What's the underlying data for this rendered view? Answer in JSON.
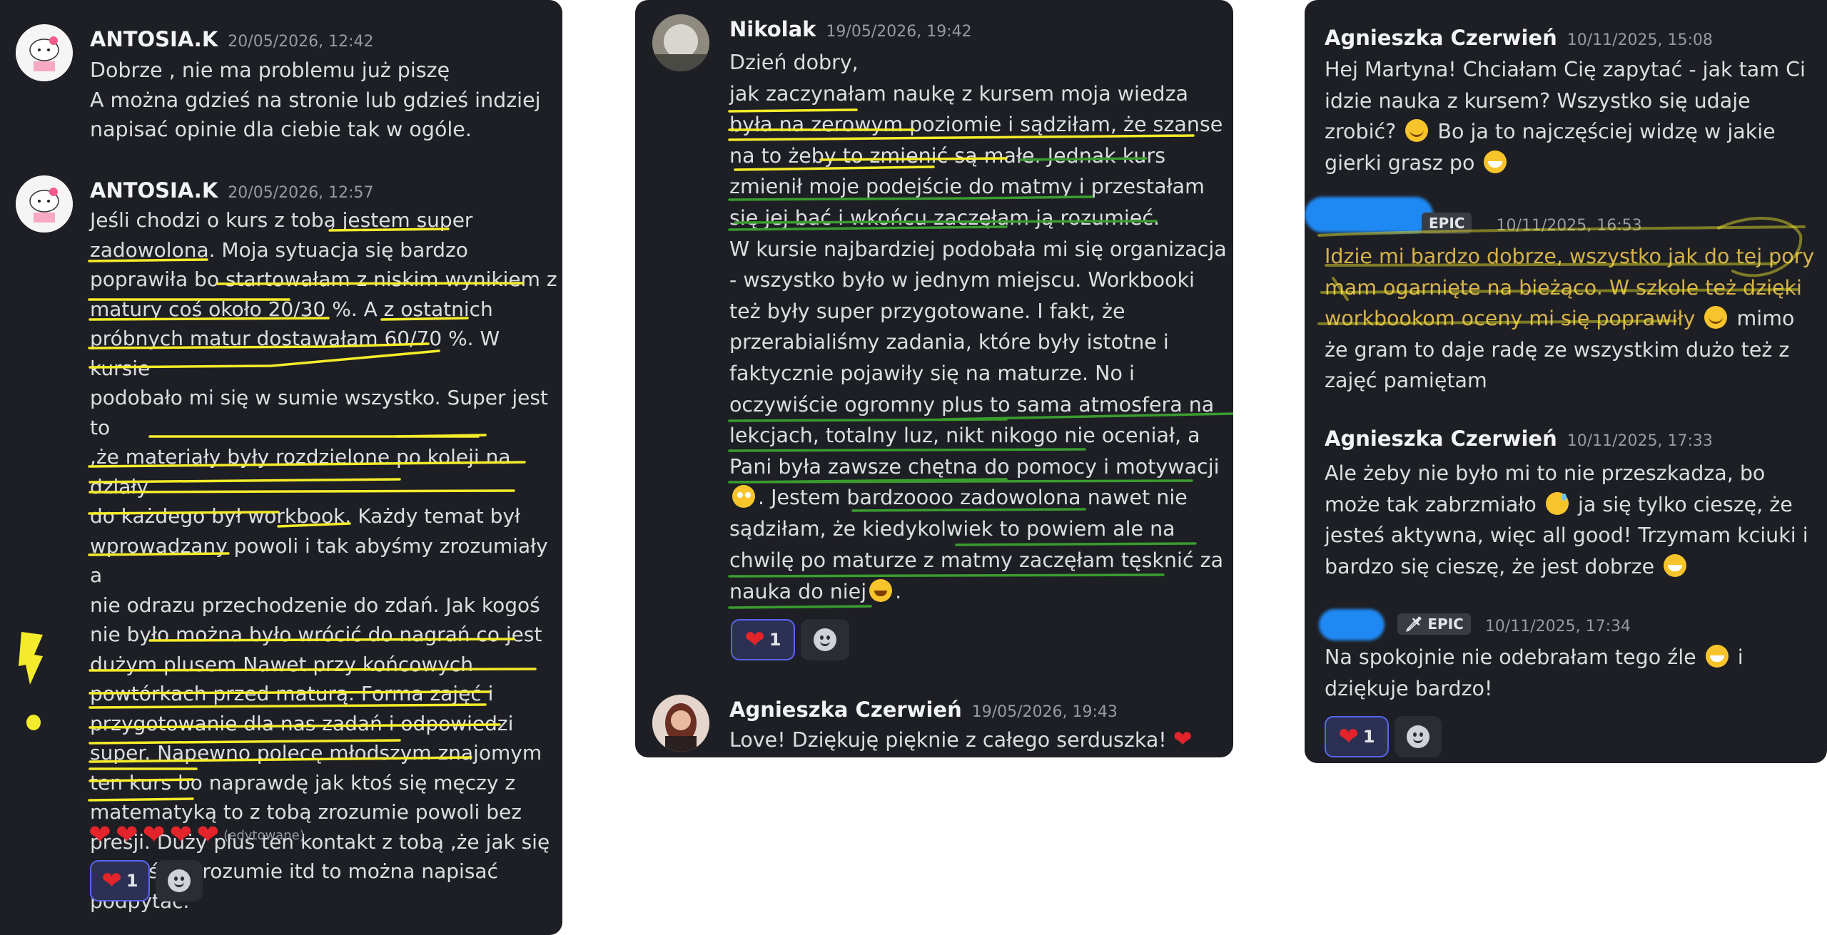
{
  "colors": {
    "panel": "#1e1f24",
    "highlight_yellow": "#f4ec2a",
    "highlight_green": "#3a9c2f",
    "heart": "#e3242b"
  },
  "panel1": {
    "msg1": {
      "author": "ANTOSIA.K",
      "time": "20/05/2026, 12:42",
      "text": "Dobrze , nie ma problemu już piszę\nA można gdzieś na stronie lub gdzieś indziej\nnapisać opinie dla ciebie tak w ogóle."
    },
    "msg2": {
      "author": "ANTOSIA.K",
      "time": "20/05/2026, 12:57",
      "text": "Jeśli chodzi o kurs z tobą jestem super\nzadowolona. Moja sytuacja się bardzo\npoprawiła bo startowałam z niskim wynikiem z\nmatury coś około 20/30 %. A z ostatnich\npróbnych matur dostawałam 60/70 %. W kursie\npodobało mi się w sumie wszystko. Super jest to\n,że materiały były rozdzielone  po koleji na działy\ndo każdego był workbook. Każdy temat był\nwprowadzany powoli i tak abyśmy zrozumiały a\nnie odrazu przechodzenie do zdań. Jak kogoś\nnie było można było wrócić do nagrań co jest\ndużym plusem.Nawet przy końcowych\npowtórkach przed maturą. Forma zajęć i\nprzygotowanie dla nas zadań i odpowiedzi\nsuper. Napewno polecę młodszym znajomym\nten kurs bo naprawdę jak ktoś się męczy z\nmatematyką to z tobą zrozumie powoli bez\npresji. Duży plus ten kontakt z tobą ,że jak się\nczegoś nie rozumie itd to można napisać\npodpytać.",
      "edited": "(edytowane)",
      "reaction_count": "1"
    }
  },
  "panel2": {
    "msg1": {
      "author": "Nikolak",
      "time": "19/05/2026, 19:42",
      "text": "Dzień dobry,\njak zaczynałam naukę z kursem moja wiedza\nbyła na zerowym poziomie i sądziłam, że szanse\nna to żeby to zmienić są małe. Jednak kurs\nzmienił moje podejście do matmy i przestałam\nsię jej bać i wkońcu zaczęłam ją rozumieć.\nW kursie najbardziej podobała mi się organizacja\n- wszystko było w jednym miejscu. Workbooki\nteż były super przygotowane. I fakt, że\nprzerabialiśmy zadania, które były istotne i\nfaktycznie pojawiły się na maturze. No i\noczywiście ogromny plus to sama atmosfera na\nlekcjach, totalny luz, nikt nikogo nie oceniał, a\nPani była zawsze chętna do pomocy i motywacji",
      "line15": ". Jestem bardzoooo zadowolona nawet nie",
      "text_rest": "sądziłam, że kiedykolwiek to powiem ale na\nchwilę po maturze z matmy zaczęłam tęsknić za",
      "last_line": "nauka do niej",
      "last_tail": ".",
      "reaction_count": "1"
    },
    "msg2": {
      "author": "Agnieszka Czerwień",
      "time": "19/05/2026, 19:43",
      "text": "Love! Dziękuję pięknie z całego serduszka!"
    }
  },
  "panel3": {
    "msg1": {
      "author": "Agnieszka Czerwień",
      "time": "10/11/2025, 15:08",
      "line1": "Hej Martyna! Chciałam Cię zapytać - jak tam Ci",
      "line2": "idzie nauka z kursem? Wszystko się udaje",
      "line3": "zrobić?",
      "line3b": " Bo ja to najczęściej widzę w jakie",
      "line4": "gierki grasz po"
    },
    "msg2": {
      "tag": "EPIC",
      "time": "10/11/2025, 16:53",
      "line1": "Idzie mi bardzo dobrze, wszystko jak do tej pory",
      "line2": "mam ogarnięte na bieżąco. W szkole też dzięki",
      "line3": "workbookom oceny mi się poprawiły",
      "line3b": " mimo",
      "line4": "że gram to daje radę ze wszystkim dużo też z\nzajęć pamiętam"
    },
    "msg3": {
      "author": "Agnieszka Czerwień",
      "time": "10/11/2025, 17:33",
      "line1": "Ale żeby nie było mi to nie przeszkadza, bo",
      "line2": "może tak zabrzmiało",
      "line2b": " ja się tylko cieszę, że",
      "line3": "jesteś aktywna, więc all good! Trzymam kciuki i",
      "line4": "bardzo się cieszę, że jest dobrze"
    },
    "msg4": {
      "tag": "EPIC",
      "time": "10/11/2025, 17:34",
      "line1": "Na spokojnie nie odebrałam tego źle",
      "line1b": " i",
      "line2": "dziękuje bardzo!",
      "reaction_count": "1"
    }
  }
}
